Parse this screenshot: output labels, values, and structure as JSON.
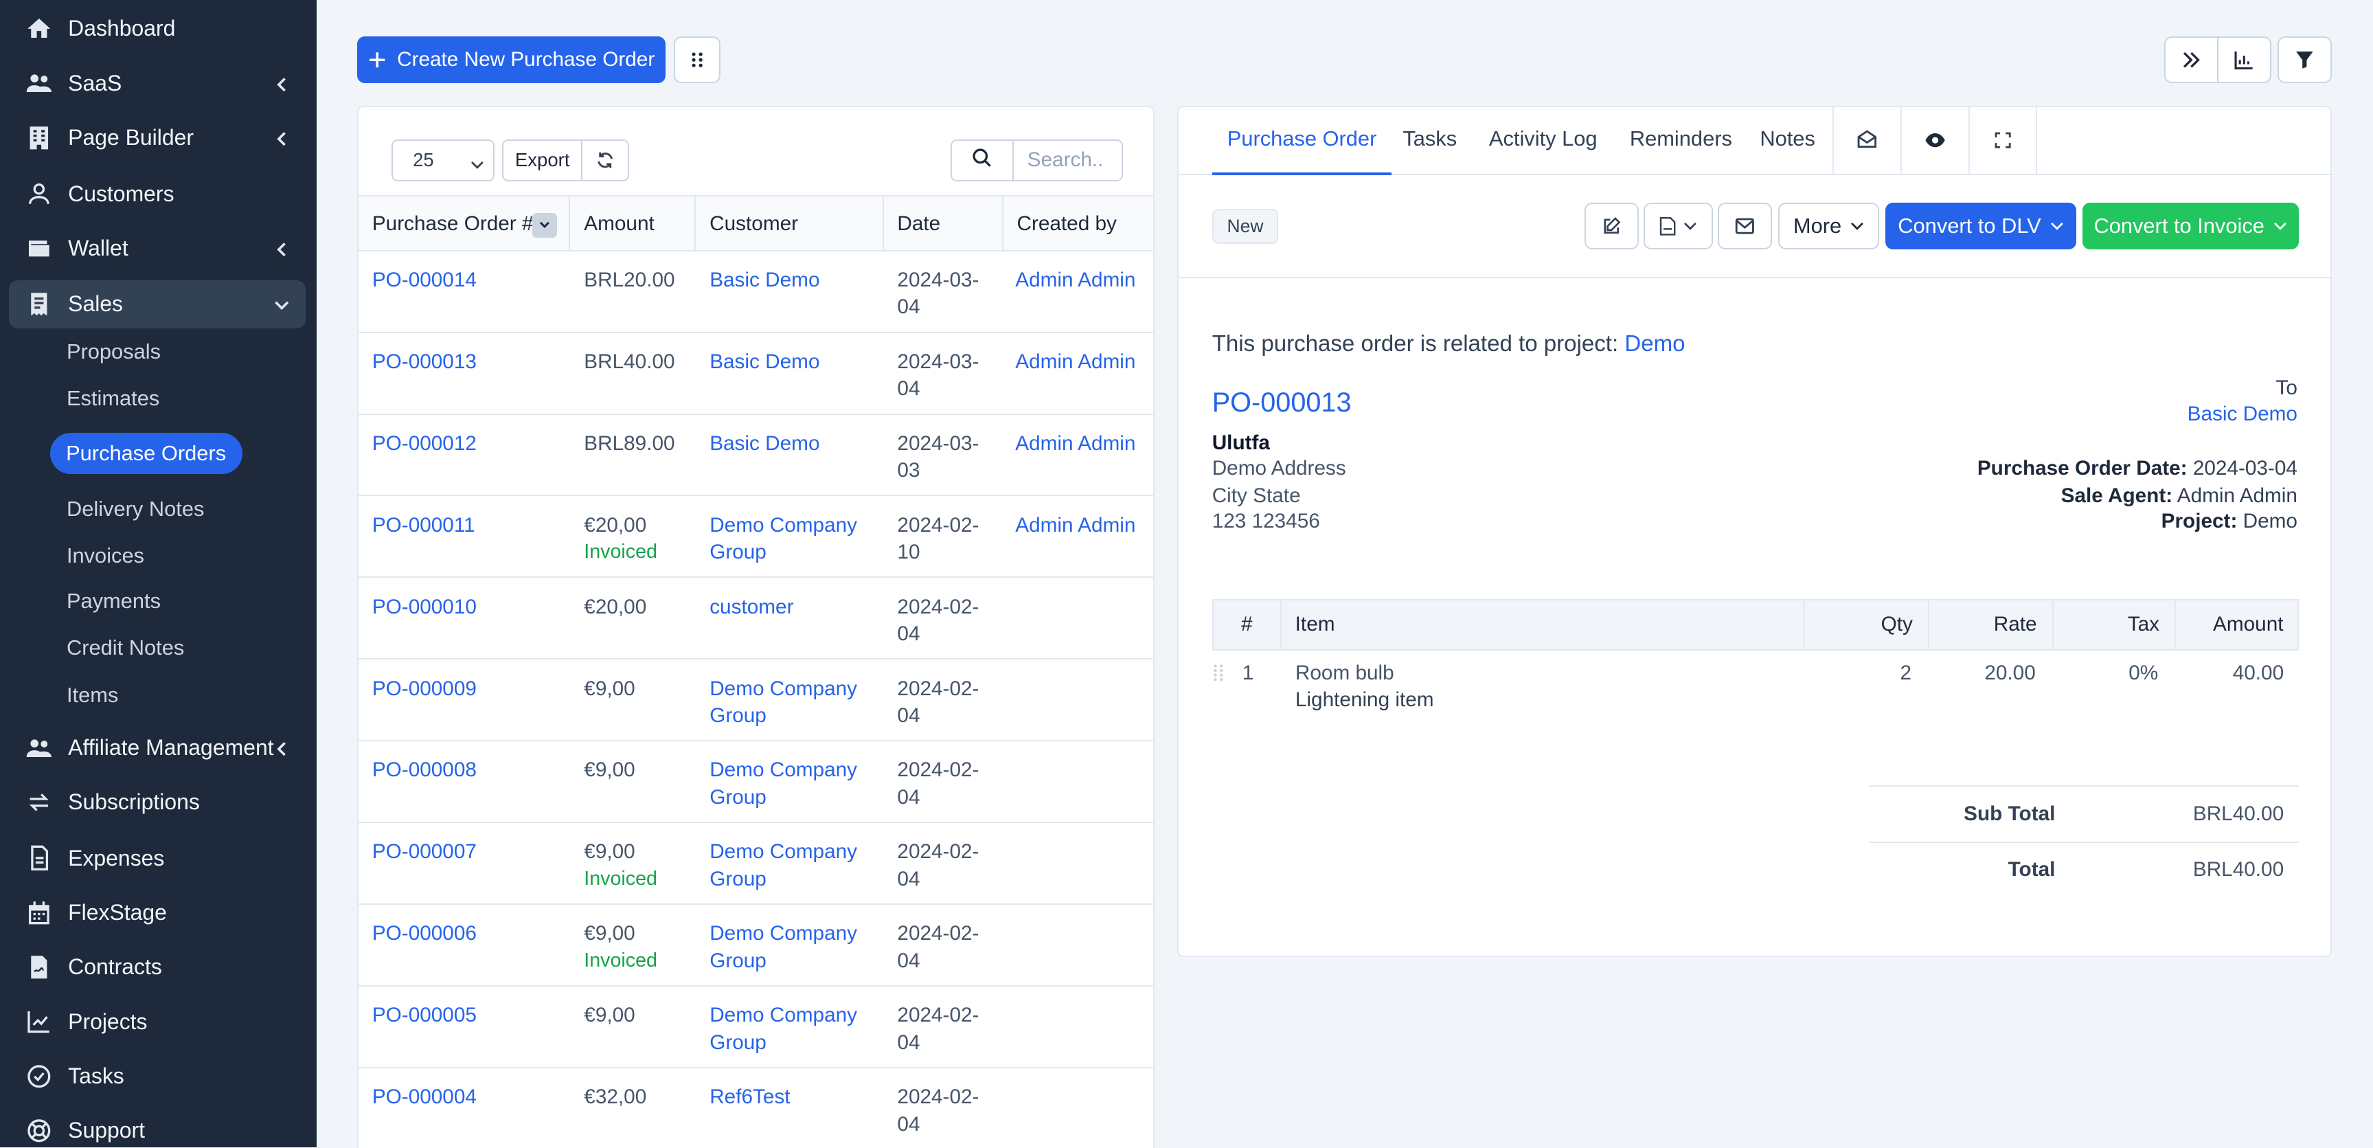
{
  "sidebar": {
    "items": [
      {
        "label": "Dashboard"
      },
      {
        "label": "SaaS"
      },
      {
        "label": "Page Builder"
      },
      {
        "label": "Customers"
      },
      {
        "label": "Wallet"
      },
      {
        "label": "Sales"
      },
      {
        "label": "Affiliate Management"
      },
      {
        "label": "Subscriptions"
      },
      {
        "label": "Expenses"
      },
      {
        "label": "FlexStage"
      },
      {
        "label": "Contracts"
      },
      {
        "label": "Projects"
      },
      {
        "label": "Tasks"
      },
      {
        "label": "Support"
      }
    ],
    "sales_sub": [
      "Proposals",
      "Estimates",
      "Purchase Orders",
      "Delivery Notes",
      "Invoices",
      "Payments",
      "Credit Notes",
      "Items"
    ]
  },
  "toolbar": {
    "create_label": "Create New Purchase Order"
  },
  "list": {
    "page_size": "25",
    "export_label": "Export",
    "search_placeholder": "Search..",
    "columns": [
      "Purchase Order #",
      "Amount",
      "Customer",
      "Date",
      "Created by"
    ],
    "rows": [
      {
        "num": "PO-000014",
        "amount": "BRL20.00",
        "status": "",
        "customer": "Basic Demo",
        "date": "2024-03-04",
        "by": "Admin Admin"
      },
      {
        "num": "PO-000013",
        "amount": "BRL40.00",
        "status": "",
        "customer": "Basic Demo",
        "date": "2024-03-04",
        "by": "Admin Admin"
      },
      {
        "num": "PO-000012",
        "amount": "BRL89.00",
        "status": "",
        "customer": "Basic Demo",
        "date": "2024-03-03",
        "by": "Admin Admin"
      },
      {
        "num": "PO-000011",
        "amount": "€20,00",
        "status": "Invoiced",
        "customer": "Demo Company Group",
        "date": "2024-02-10",
        "by": "Admin Admin"
      },
      {
        "num": "PO-000010",
        "amount": "€20,00",
        "status": "",
        "customer": "customer",
        "date": "2024-02-04",
        "by": ""
      },
      {
        "num": "PO-000009",
        "amount": "€9,00",
        "status": "",
        "customer": "Demo Company Group",
        "date": "2024-02-04",
        "by": ""
      },
      {
        "num": "PO-000008",
        "amount": "€9,00",
        "status": "",
        "customer": "Demo Company Group",
        "date": "2024-02-04",
        "by": ""
      },
      {
        "num": "PO-000007",
        "amount": "€9,00",
        "status": "Invoiced",
        "customer": "Demo Company Group",
        "date": "2024-02-04",
        "by": ""
      },
      {
        "num": "PO-000006",
        "amount": "€9,00",
        "status": "Invoiced",
        "customer": "Demo Company Group",
        "date": "2024-02-04",
        "by": ""
      },
      {
        "num": "PO-000005",
        "amount": "€9,00",
        "status": "",
        "customer": "Demo Company Group",
        "date": "2024-02-04",
        "by": ""
      },
      {
        "num": "PO-000004",
        "amount": "€32,00",
        "status": "",
        "customer": "Ref6Test",
        "date": "2024-02-04",
        "by": ""
      }
    ]
  },
  "detail": {
    "tabs": [
      "Purchase Order",
      "Tasks",
      "Activity Log",
      "Reminders",
      "Notes"
    ],
    "status_badge": "New",
    "more_label": "More",
    "convert_dlv_label": "Convert to DLV",
    "convert_invoice_label": "Convert to Invoice",
    "project_text": "This purchase order is related to project:",
    "project_link": "Demo",
    "po_number": "PO-000013",
    "from": {
      "name": "Ulutfa",
      "address": "Demo Address",
      "city": "City State",
      "zip": "123 123456"
    },
    "to_label": "To",
    "to_customer": "Basic Demo",
    "po_date_label": "Purchase Order Date:",
    "po_date": "2024-03-04",
    "agent_label": "Sale Agent:",
    "agent": "Admin Admin",
    "project_label": "Project:",
    "project": "Demo",
    "items_columns": [
      "#",
      "Item",
      "Qty",
      "Rate",
      "Tax",
      "Amount"
    ],
    "items": [
      {
        "n": "1",
        "name": "Room bulb",
        "desc": "Lightening item",
        "qty": "2",
        "rate": "20.00",
        "tax": "0%",
        "amount": "40.00"
      }
    ],
    "subtotal_label": "Sub Total",
    "subtotal": "BRL40.00",
    "total_label": "Total",
    "total": "BRL40.00"
  },
  "colors": {
    "sidebar_bg": "#1e293b",
    "primary": "#2563eb",
    "success": "#22c55e",
    "invoiced": "#16a34a"
  }
}
